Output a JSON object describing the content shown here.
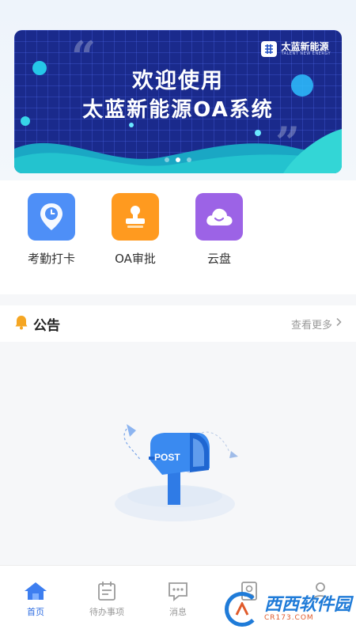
{
  "banner": {
    "line1": "欢迎使用",
    "line2": "太蓝新能源OA系统",
    "logo_text": "太蓝新能源",
    "logo_sub": "TALENT NEW ENERGY",
    "slide_count": 3,
    "active_slide": 2
  },
  "quick_actions": [
    {
      "label": "考勤打卡",
      "icon": "location-pin-clock-icon",
      "color": "#4e8ff7"
    },
    {
      "label": "OA审批",
      "icon": "stamp-icon",
      "color": "#ff9a1f"
    },
    {
      "label": "云盘",
      "icon": "cloud-icon",
      "color": "#9c63e6"
    }
  ],
  "notice": {
    "title": "公告",
    "more": "查看更多"
  },
  "empty_state": {
    "mailbox_text": "POST"
  },
  "tabs": [
    {
      "label": "首页",
      "icon": "home-icon",
      "active": true
    },
    {
      "label": "待办事项",
      "icon": "calendar-list-icon",
      "active": false
    },
    {
      "label": "消息",
      "icon": "chat-bubble-icon",
      "active": false
    },
    {
      "label": "",
      "icon": "contacts-icon",
      "active": false
    },
    {
      "label": "",
      "icon": "profile-icon",
      "active": false
    }
  ],
  "watermark": {
    "text": "西西软件园",
    "sub": "CR173.COM"
  },
  "colors": {
    "accent": "#2f6de1",
    "banner_bg": "#1a2a8c",
    "wave": "#23c3cf"
  }
}
